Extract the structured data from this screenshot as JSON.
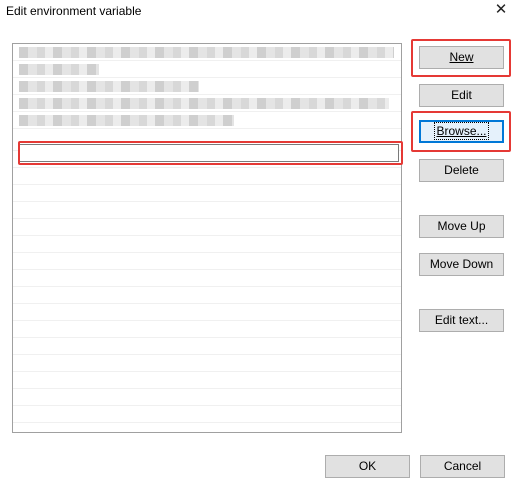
{
  "window": {
    "title": "Edit environment variable"
  },
  "buttons": {
    "new": "New",
    "edit": "Edit",
    "browse": "Browse...",
    "delete": "Delete",
    "move_up": "Move Up",
    "move_down": "Move Down",
    "edit_text": "Edit text...",
    "ok": "OK",
    "cancel": "Cancel"
  },
  "icons": {
    "close": "close-icon"
  },
  "colors": {
    "highlight": "#e53935",
    "focus": "#0078d7"
  }
}
